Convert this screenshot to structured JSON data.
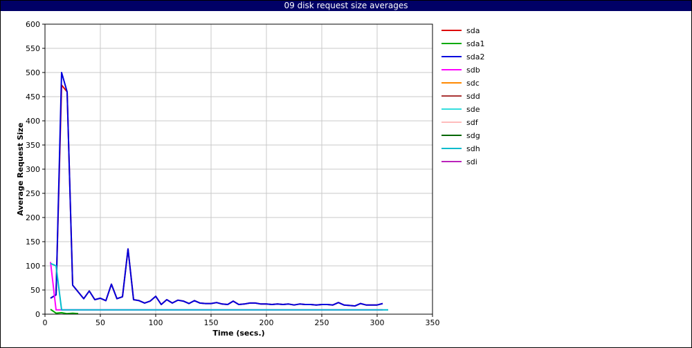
{
  "title": "09 disk request size averages",
  "chart_data": {
    "type": "line",
    "title": "09 disk request size averages",
    "xlabel": "Time (secs.)",
    "ylabel": "Average Request Size",
    "xlim": [
      0,
      350
    ],
    "ylim": [
      0,
      600
    ],
    "xticks": [
      0,
      50,
      100,
      150,
      200,
      250,
      300,
      350
    ],
    "yticks": [
      0,
      50,
      100,
      150,
      200,
      250,
      300,
      350,
      400,
      450,
      500,
      550,
      600
    ],
    "grid": true,
    "legend_position": "right",
    "series": [
      {
        "name": "sda",
        "color": "#dd0000",
        "x": [
          5,
          10,
          15,
          20,
          25,
          35,
          40,
          45,
          50,
          55,
          60,
          65,
          70,
          75,
          80,
          85,
          90,
          95,
          100,
          105,
          110,
          115,
          120,
          125,
          130,
          135,
          140,
          145,
          150,
          155,
          160,
          165,
          170,
          175,
          180,
          185,
          190,
          195,
          200,
          205,
          210,
          215,
          220,
          225,
          230,
          235,
          240,
          245,
          250,
          255,
          260,
          265,
          270,
          275,
          280,
          285,
          290,
          295,
          300,
          305
        ],
        "y": [
          33,
          40,
          474,
          460,
          60,
          32,
          48,
          30,
          33,
          28,
          62,
          32,
          36,
          135,
          30,
          28,
          23,
          27,
          37,
          20,
          30,
          23,
          29,
          27,
          22,
          28,
          23,
          22,
          22,
          24,
          21,
          20,
          27,
          20,
          21,
          23,
          23,
          21,
          21,
          20,
          21,
          20,
          21,
          19,
          21,
          20,
          20,
          19,
          20,
          20,
          19,
          24,
          19,
          18,
          17,
          22,
          19,
          19,
          19,
          22
        ]
      },
      {
        "name": "sda1",
        "color": "#00aa00",
        "x": [
          5,
          10,
          15,
          20,
          25,
          30
        ],
        "y": [
          10,
          2,
          3,
          1,
          2,
          1
        ]
      },
      {
        "name": "sda2",
        "color": "#0000dd",
        "x": [
          5,
          10,
          15,
          20,
          25,
          35,
          40,
          45,
          50,
          55,
          60,
          65,
          70,
          75,
          80,
          85,
          90,
          95,
          100,
          105,
          110,
          115,
          120,
          125,
          130,
          135,
          140,
          145,
          150,
          155,
          160,
          165,
          170,
          175,
          180,
          185,
          190,
          195,
          200,
          205,
          210,
          215,
          220,
          225,
          230,
          235,
          240,
          245,
          250,
          255,
          260,
          265,
          270,
          275,
          280,
          285,
          290,
          295,
          300,
          305
        ],
        "y": [
          33,
          40,
          500,
          460,
          60,
          32,
          48,
          30,
          33,
          28,
          62,
          32,
          36,
          135,
          30,
          28,
          23,
          27,
          37,
          20,
          30,
          23,
          29,
          27,
          22,
          28,
          23,
          22,
          22,
          24,
          21,
          20,
          27,
          20,
          21,
          23,
          23,
          21,
          21,
          20,
          21,
          20,
          21,
          19,
          21,
          20,
          20,
          19,
          20,
          20,
          19,
          24,
          19,
          18,
          17,
          22,
          19,
          19,
          19,
          22
        ]
      },
      {
        "name": "sdb",
        "color": "#ff00ff",
        "x": [
          5,
          10,
          15,
          20,
          50,
          100,
          150,
          200,
          250,
          300,
          305
        ],
        "y": [
          108,
          9,
          9,
          9,
          9,
          9,
          9,
          9,
          9,
          9,
          9
        ]
      },
      {
        "name": "sdc",
        "color": "#ff8800",
        "x": [],
        "y": []
      },
      {
        "name": "sdd",
        "color": "#aa3333",
        "x": [],
        "y": []
      },
      {
        "name": "sde",
        "color": "#33dddd",
        "x": [],
        "y": []
      },
      {
        "name": "sdf",
        "color": "#ffbbbb",
        "x": [],
        "y": []
      },
      {
        "name": "sdg",
        "color": "#006600",
        "x": [],
        "y": []
      },
      {
        "name": "sdh",
        "color": "#00bbcc",
        "x": [
          5,
          10,
          15,
          20,
          50,
          100,
          150,
          200,
          250,
          300,
          310
        ],
        "y": [
          105,
          100,
          9,
          9,
          9,
          9,
          9,
          9,
          9,
          9,
          9
        ]
      },
      {
        "name": "sdi",
        "color": "#bb22bb",
        "x": [],
        "y": []
      }
    ]
  }
}
